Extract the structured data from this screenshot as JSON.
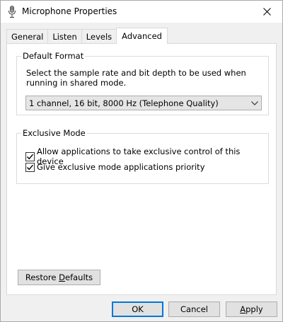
{
  "window": {
    "title": "Microphone Properties",
    "icon": "microphone-icon",
    "close_icon": "close-icon"
  },
  "tabs": [
    {
      "label": "General"
    },
    {
      "label": "Listen"
    },
    {
      "label": "Levels"
    },
    {
      "label": "Advanced",
      "active": true
    }
  ],
  "default_format": {
    "legend": "Default Format",
    "description": "Select the sample rate and bit depth to be used when running in shared mode.",
    "selected": "1 channel, 16 bit, 8000 Hz (Telephone Quality)"
  },
  "exclusive_mode": {
    "legend": "Exclusive Mode",
    "options": [
      {
        "label": "Allow applications to take exclusive control of this device",
        "checked": true
      },
      {
        "label": "Give exclusive mode applications priority",
        "checked": true
      }
    ]
  },
  "buttons": {
    "restore_pre": "Restore ",
    "restore_ul": "D",
    "restore_post": "efaults",
    "ok": "OK",
    "cancel": "Cancel",
    "apply_ul": "A",
    "apply_post": "pply"
  },
  "colors": {
    "accent": "#0078d7"
  }
}
